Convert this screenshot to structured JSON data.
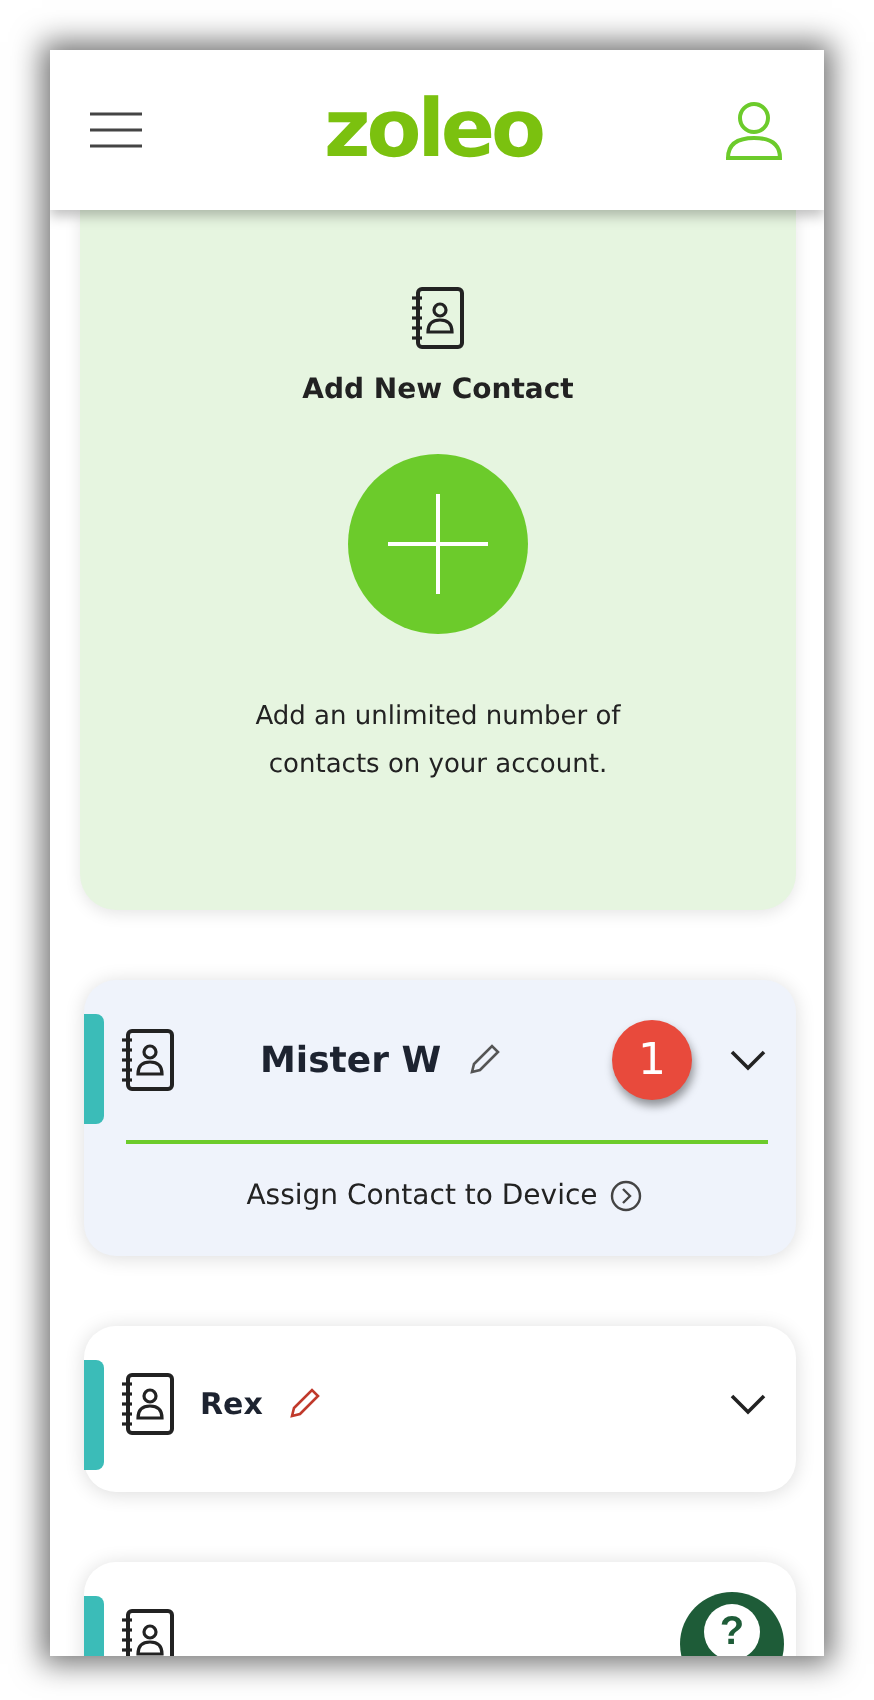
{
  "header": {
    "logo": "zoleo"
  },
  "add_contact": {
    "title": "Add New Contact",
    "description": "Add an unlimited number of contacts on your account."
  },
  "contacts": [
    {
      "name": "Mister W",
      "expanded": true,
      "badge": "1",
      "action": "Assign Contact to Device"
    },
    {
      "name": "Rex",
      "expanded": false
    },
    {
      "expanded": false
    }
  ],
  "help_button": {
    "label": "?"
  }
}
